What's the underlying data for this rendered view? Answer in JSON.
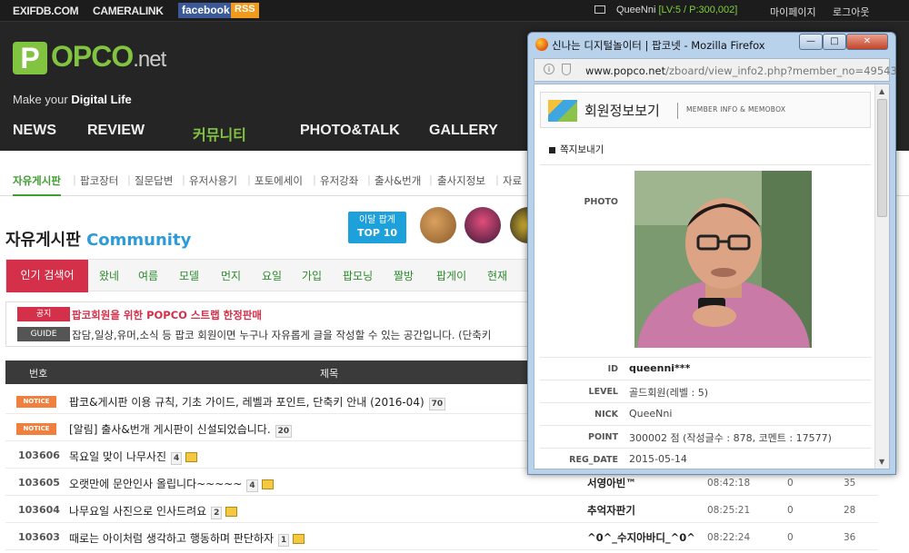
{
  "topbar": {
    "links": [
      "EXIFDB.COM",
      "CAMERALINK"
    ],
    "facebook": "facebook",
    "rss": "RSS",
    "user": "QueeNni",
    "level": "[LV:5 / P:300,002]",
    "mypage": "마이페이지",
    "logout": "로그아웃"
  },
  "logo": {
    "p": "P",
    "rest": "OPCO",
    "net": ".net",
    "tag_prefix": "Make your ",
    "tag_bold": "Digital Life"
  },
  "nav": [
    "NEWS",
    "REVIEW",
    "커뮤니티",
    "PHOTO&TALK",
    "GALLERY"
  ],
  "subnav": [
    "자유게시판",
    "팝코장터",
    "질문답변",
    "유저사용기",
    "포토에세이",
    "유저강좌",
    "출사&번개",
    "출사지정보",
    "자료"
  ],
  "board": {
    "title": "자유게시판",
    "title_en": "Community",
    "top_line1": "이달 팝게",
    "top_line2": "TOP 10"
  },
  "keywords": {
    "label": "인기 검색어",
    "items": [
      "왔네",
      "여름",
      "모델",
      "먼지",
      "요일",
      "가입",
      "팝모닝",
      "짤방",
      "팝게이",
      "현재"
    ]
  },
  "notice": {
    "tag1": "공지",
    "text1": "팝코회원을 위한 POPCO 스트랩 한정판매",
    "tag2": "GUIDE",
    "text2": "잡담,일상,유머,소식 등 팝코 회원이면 누구나 자유롭게 글을 작성할 수 있는 공간입니다. (단축키"
  },
  "table": {
    "headers": [
      "번호",
      "제목"
    ],
    "notices": [
      {
        "tag": "NOTICE",
        "title": "팝코&게시판 이용 규칙, 기초 가이드, 레벨과 포인트, 단축키 안내 (2016-04)",
        "count": "70"
      },
      {
        "tag": "NOTICE",
        "title": "[알림] 출사&번개 게시판이 신설되었습니다.",
        "count": "20"
      }
    ],
    "rows": [
      {
        "num": "103606",
        "title": "목요일 맞이 나무사진",
        "count": "4",
        "name": "",
        "date": "",
        "zero": "",
        "hits": ""
      },
      {
        "num": "103605",
        "title": "오랫만에 문안인사 올립니다~~~~~",
        "count": "4",
        "name": "서영아빈™",
        "date": "08:42:18",
        "zero": "0",
        "hits": "35"
      },
      {
        "num": "103604",
        "title": "나무요일 사진으로 인사드려요",
        "count": "2",
        "name": "추억자판기",
        "date": "08:25:21",
        "zero": "0",
        "hits": "28"
      },
      {
        "num": "103603",
        "title": "때로는 아이처럼 생각하고 행동하며 판단하자",
        "count": "1",
        "name": "^0^_수지아바디_^0^",
        "date": "08:22:24",
        "zero": "0",
        "hits": "36"
      }
    ]
  },
  "popup": {
    "title": "신나는 디지털놀이터 | 팝코넷 - Mozilla Firefox",
    "url_host": "www.popco.net",
    "url_path": "/zboard/view_info2.php?member_no=49543",
    "header_title": "회원정보보기",
    "header_en": "MEMBER INFO & MEMOBOX",
    "memo": "쪽지보내기",
    "photo_label": "PHOTO",
    "fields": [
      {
        "label": "ID",
        "value": "queenni***"
      },
      {
        "label": "LEVEL",
        "value": "골드회원(레벨 : 5)"
      },
      {
        "label": "NICK",
        "value": "QueeNni"
      },
      {
        "label": "POINT",
        "value": "300002 점 (작성글수 : 878, 코멘트 : 17577)"
      },
      {
        "label": "REG_DATE",
        "value": "2015-05-14"
      }
    ]
  },
  "colors": {
    "accent_green": "#82c341",
    "accent_red": "#d5304a",
    "accent_blue": "#1ea0db",
    "notice_orange": "#f08040"
  }
}
